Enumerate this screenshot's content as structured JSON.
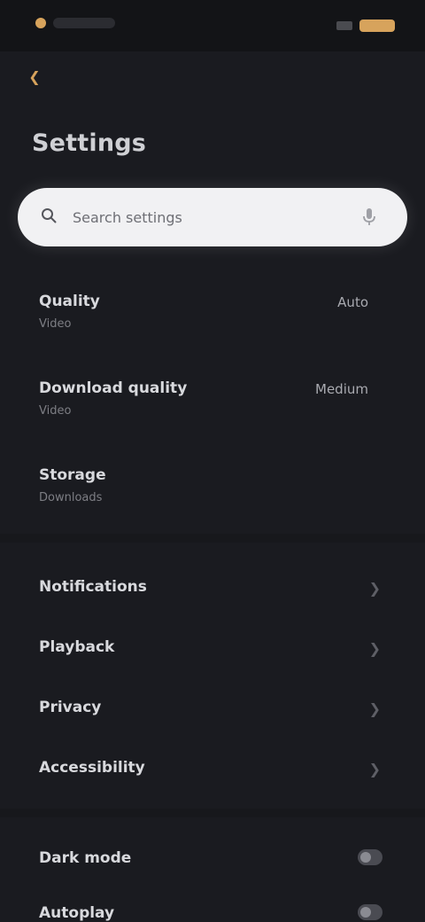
{
  "status_bar": {
    "accent": "#d7a35c"
  },
  "header": {
    "title": "Settings"
  },
  "search": {
    "placeholder": "Search settings"
  },
  "section1": {
    "rows": [
      {
        "title": "Quality",
        "subtitle": "Video",
        "value": "Auto"
      },
      {
        "title": "Download quality",
        "subtitle": "Video",
        "value": "Medium"
      },
      {
        "title": "Storage",
        "subtitle": "Downloads",
        "value": ""
      }
    ]
  },
  "section2": {
    "rows": [
      {
        "title": "Notifications"
      },
      {
        "title": "Playback"
      },
      {
        "title": "Privacy"
      },
      {
        "title": "Accessibility"
      }
    ]
  },
  "section3": {
    "rows": [
      {
        "title": "Dark mode"
      },
      {
        "title": "Autoplay"
      }
    ]
  },
  "icons": {
    "back": "chevron-left-icon",
    "search": "search-icon",
    "mic": "mic-icon",
    "chevron": "chevron-right-icon"
  }
}
